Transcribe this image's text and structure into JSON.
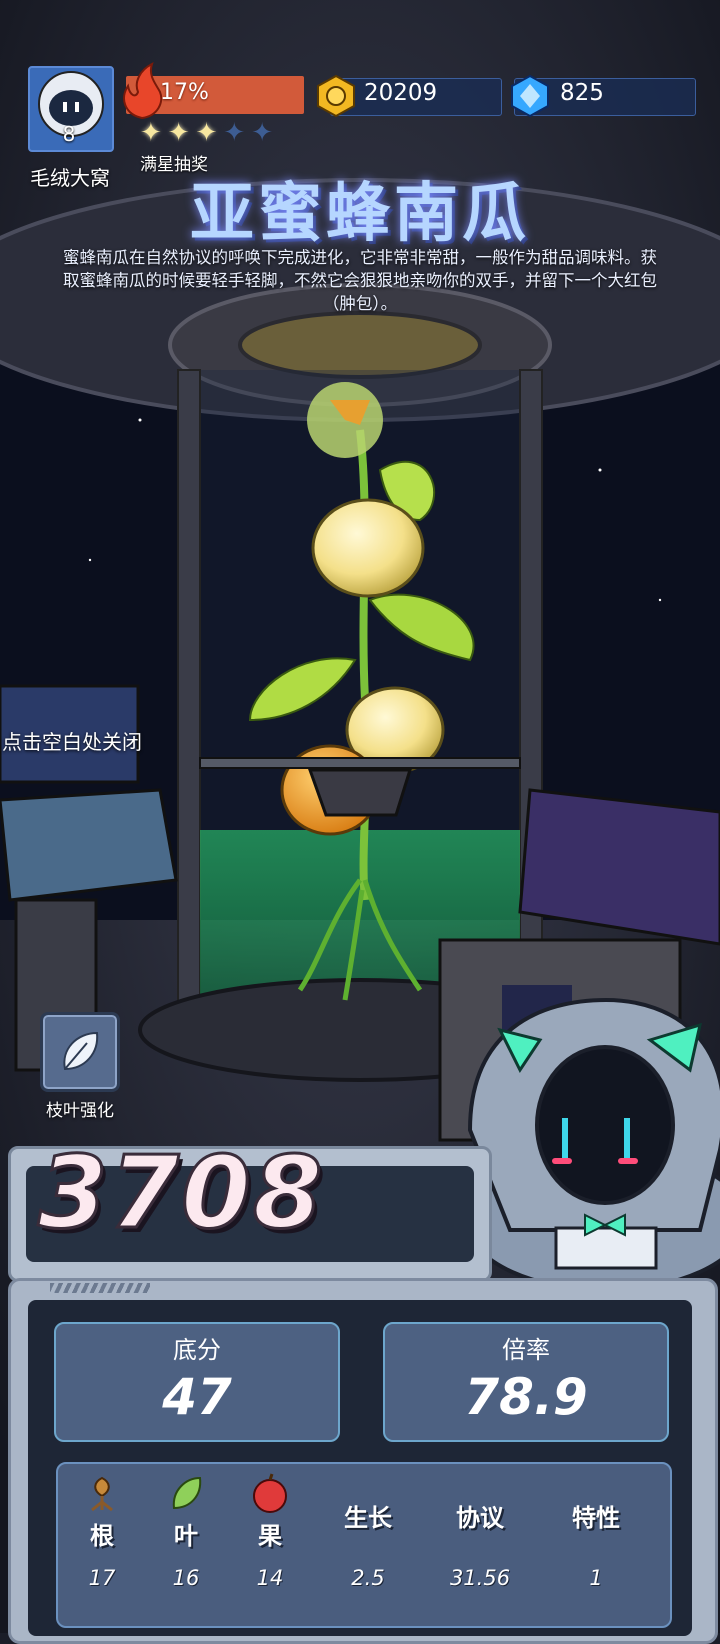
{
  "player": {
    "level": "8",
    "name": "毛绒大窝"
  },
  "energy": {
    "percent_text": "17%",
    "lottery_label": "满星抽奖",
    "stars_filled": 3,
    "stars_total": 5
  },
  "resources": {
    "coins": "20209",
    "gems": "825"
  },
  "plant": {
    "title": "亚蜜蜂南瓜",
    "description": "蜜蜂南瓜在自然协议的呼唤下完成进化，它非常非常甜，一般作为甜品调味料。获取蜜蜂南瓜的时候要轻手轻脚，不然它会狠狠地亲吻你的双手，并留下一个大红包（肿包）。"
  },
  "hints": {
    "close": "点击空白处关闭",
    "leaf_enhance": "枝叶强化"
  },
  "score": {
    "total": "3708",
    "base_label": "底分",
    "base_value": "47",
    "rate_label": "倍率",
    "rate_value": "78.9"
  },
  "details": {
    "columns": [
      {
        "label": "根",
        "value": "17",
        "icon": "root-icon"
      },
      {
        "label": "叶",
        "value": "16",
        "icon": "leaf-icon"
      },
      {
        "label": "果",
        "value": "14",
        "icon": "apple-icon"
      },
      {
        "label": "生长",
        "value": "2.5"
      },
      {
        "label": "协议",
        "value": "31.56"
      },
      {
        "label": "特性",
        "value": "1"
      }
    ]
  },
  "colors": {
    "accent": "#d25a3a",
    "panel": "#4d6182",
    "glow": "#2fe06a"
  }
}
